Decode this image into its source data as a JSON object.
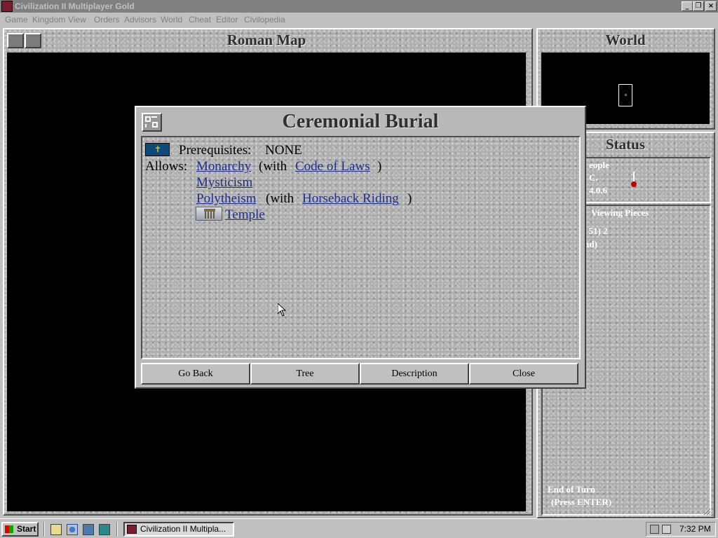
{
  "window": {
    "title": "Civilization II Multiplayer Gold"
  },
  "menus": [
    "Game",
    "Kingdom",
    "View",
    "Orders",
    "Advisors",
    "World",
    "Cheat",
    "Editor",
    "Civilopedia"
  ],
  "map_panel": {
    "title": "Roman Map"
  },
  "world_panel": {
    "title": "World"
  },
  "status_panel": {
    "title": "Status",
    "lines": [
      "eople",
      "C.",
      "4.0.6"
    ],
    "viewing": "Viewing Pieces",
    "coords": ", 51) 2",
    "terrain": "nd)",
    "end_turn_1": "End of Turn",
    "end_turn_2": "(Press ENTER)"
  },
  "dialog": {
    "title": "Ceremonial Burial",
    "prereq_label": "Prerequisites:",
    "prereq_value": "NONE",
    "allows_label": "Allows:",
    "allows": {
      "monarchy": "Monarchy",
      "with_1": "(with",
      "code_of_laws": "Code of Laws",
      "close_paren_1": ")",
      "mysticism": "Mysticism",
      "polytheism": "Polytheism",
      "with_2": "(with",
      "horseback_riding": "Horseback Riding",
      "close_paren_2": ")",
      "temple": "Temple"
    },
    "buttons": {
      "go_back": "Go Back",
      "tree": "Tree",
      "description": "Description",
      "close": "Close"
    }
  },
  "taskbar": {
    "start": "Start",
    "task_label": "Civilization II Multipla...",
    "clock": "7:32 PM"
  },
  "icons": {
    "window_controls": [
      "minimize-icon",
      "restore-icon",
      "close-icon"
    ],
    "dialog_flag": "cross-flag-icon",
    "temple": "temple-icon"
  }
}
